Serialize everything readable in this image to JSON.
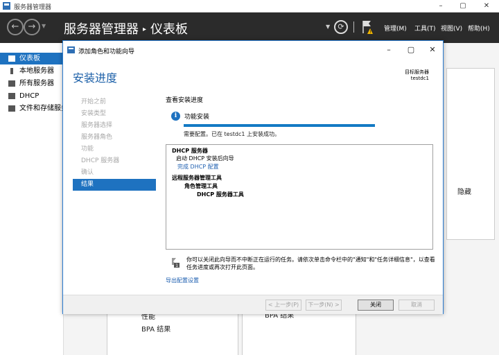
{
  "window": {
    "title": "服务器管理器",
    "controls": {
      "minimize": "–",
      "maximize": "▢",
      "close": "✕"
    }
  },
  "header": {
    "back_icon": "back-arrow-icon",
    "forward_icon": "forward-arrow-icon",
    "breadcrumb_root": "服务器管理器",
    "breadcrumb_sep": "▸",
    "breadcrumb_current": "仪表板",
    "menu": {
      "manage": "管理(M)",
      "tools": "工具(T)",
      "view": "视图(V)",
      "help": "帮助(H)"
    }
  },
  "sidebar": {
    "items": [
      {
        "label": "仪表板",
        "active": true,
        "icon": "dashboard-icon"
      },
      {
        "label": "本地服务器",
        "active": false,
        "icon": "local-server-icon"
      },
      {
        "label": "所有服务器",
        "active": false,
        "icon": "all-servers-icon"
      },
      {
        "label": "DHCP",
        "active": false,
        "icon": "dhcp-icon"
      },
      {
        "label": "文件和存储服务",
        "active": false,
        "icon": "file-storage-icon"
      }
    ]
  },
  "background": {
    "hide_label": "隐藏",
    "performance_label": "性能",
    "bpa_label_1": "BPA 结果",
    "bpa_label_2": "BPA 结果"
  },
  "wizard": {
    "title": "添加角色和功能向导",
    "heading": "安装进度",
    "target_server_label": "目标服务器",
    "target_server_name": "testdc1",
    "steps": [
      {
        "label": "开始之前",
        "active": false
      },
      {
        "label": "安装类型",
        "active": false
      },
      {
        "label": "服务器选择",
        "active": false
      },
      {
        "label": "服务器角色",
        "active": false
      },
      {
        "label": "功能",
        "active": false
      },
      {
        "label": "DHCP 服务器",
        "active": false
      },
      {
        "label": "确认",
        "active": false
      },
      {
        "label": "结果",
        "active": true
      }
    ],
    "view_progress": "查看安装进度",
    "feature_install": "功能安装",
    "progress_percent": 100,
    "status_text": "需要配置。已在 testdc1 上安装成功。",
    "results": {
      "dhcp_server": "DHCP 服务器",
      "launch_wizard": "启动 DHCP 安装后向导",
      "complete_config": "完成 DHCP 配置",
      "rsat": "远程服务器管理工具",
      "role_admin_tools": "角色管理工具",
      "dhcp_tools": "DHCP 服务器工具"
    },
    "note_text": "你可以关闭此向导而不中断正在运行的任务。请依次单击命令栏中的\"通知\"和\"任务详细信息\"，以查看任务进度或再次打开此页面。",
    "export_link": "导出配置设置",
    "buttons": {
      "prev": "< 上一步(P)",
      "next": "下一步(N) >",
      "close": "关闭",
      "cancel": "取消"
    }
  },
  "colors": {
    "accent": "#1e72c0",
    "header_bg": "#2b2b2b",
    "progress": "#147ac4",
    "link": "#1e5fb0"
  }
}
